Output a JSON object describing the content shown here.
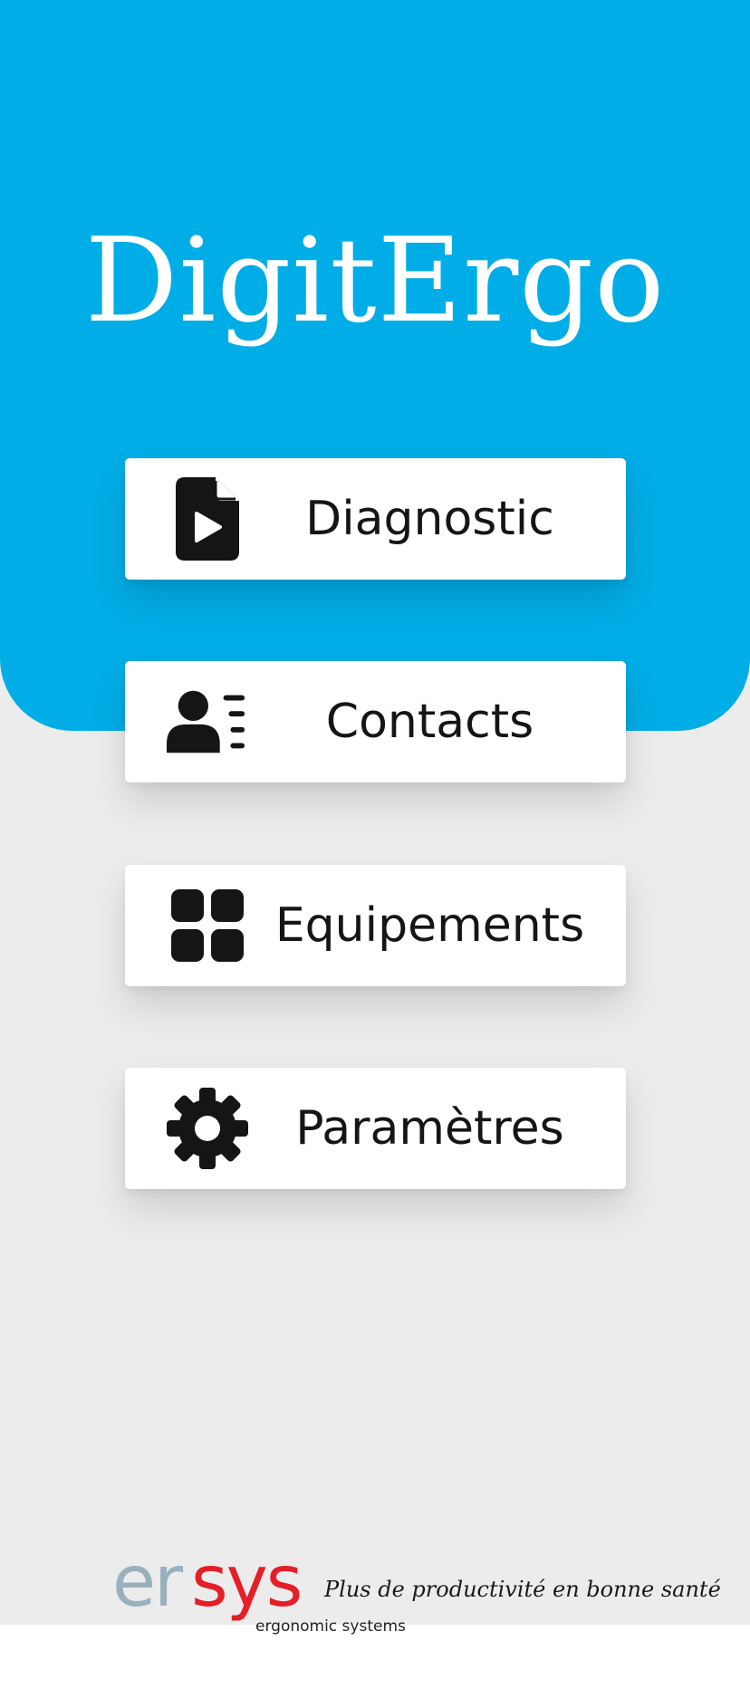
{
  "app": {
    "title": "DigitErgo"
  },
  "menu": {
    "items": [
      {
        "label": "Diagnostic",
        "icon": "file-play-icon"
      },
      {
        "label": "Contacts",
        "icon": "contact-list-icon"
      },
      {
        "label": "Equipements",
        "icon": "grid-icon"
      },
      {
        "label": "Paramètres",
        "icon": "gear-icon"
      }
    ]
  },
  "footer": {
    "logo_part1": "er",
    "logo_part2": "sys",
    "logo_subtitle": "ergonomic systems",
    "tagline": "Plus de productivité en bonne santé"
  },
  "colors": {
    "header_blue": "#00ade6",
    "background": "#ececec",
    "logo_grey": "#9ab0bd",
    "logo_red": "#e41f26",
    "icon_dark": "#151515"
  }
}
